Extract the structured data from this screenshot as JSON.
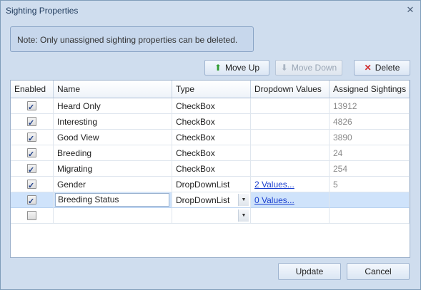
{
  "window": {
    "title": "Sighting Properties",
    "close_glyph": "✕"
  },
  "note": "Note: Only unassigned sighting properties can be deleted.",
  "toolbar": {
    "move_up": "Move Up",
    "move_up_icon": "green-up-arrow",
    "move_down": "Move Down",
    "move_down_icon": "gray-down-arrow",
    "delete": "Delete",
    "delete_icon": "red-x"
  },
  "grid": {
    "columns": [
      "Enabled",
      "Name",
      "Type",
      "Dropdown Values",
      "Assigned Sightings"
    ],
    "rows": [
      {
        "enabled": true,
        "name": "Heard Only",
        "type": "CheckBox",
        "dropdown": "",
        "assigned": "13912"
      },
      {
        "enabled": true,
        "name": "Interesting",
        "type": "CheckBox",
        "dropdown": "",
        "assigned": "4826"
      },
      {
        "enabled": true,
        "name": "Good View",
        "type": "CheckBox",
        "dropdown": "",
        "assigned": "3890"
      },
      {
        "enabled": true,
        "name": "Breeding",
        "type": "CheckBox",
        "dropdown": "",
        "assigned": "24"
      },
      {
        "enabled": true,
        "name": "Migrating",
        "type": "CheckBox",
        "dropdown": "",
        "assigned": "254"
      },
      {
        "enabled": true,
        "name": "Gender",
        "type": "DropDownList",
        "dropdown": "2 Values...",
        "assigned": "5"
      }
    ],
    "editing_row": {
      "enabled": true,
      "name": "Breeding Status",
      "type": "DropDownList",
      "dropdown": "0 Values...",
      "assigned": ""
    },
    "new_row": {
      "enabled": false,
      "name": "",
      "type": ""
    }
  },
  "footer": {
    "update": "Update",
    "cancel": "Cancel"
  },
  "colors": {
    "window_bg": "#cfddee",
    "selection": "#cfe3fb",
    "link": "#1a3fcf"
  }
}
